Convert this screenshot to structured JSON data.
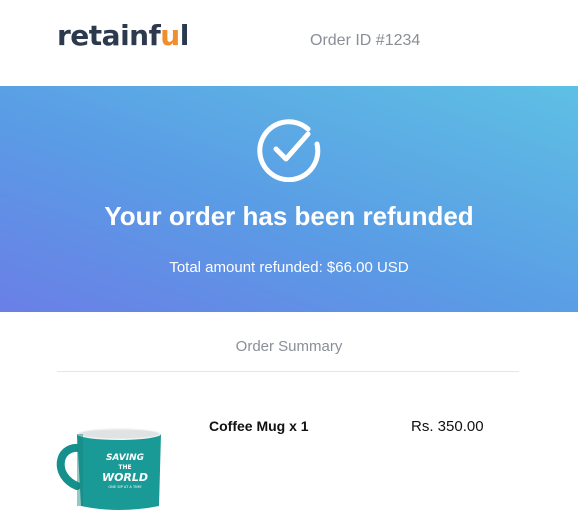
{
  "header": {
    "logo_main": "retainf",
    "logo_accent": "u",
    "logo_end": "l",
    "order_id": "Order ID #1234"
  },
  "hero": {
    "title": "Your order has been refunded",
    "subtitle": "Total amount refunded: $66.00 USD",
    "icon": "check-circle-icon"
  },
  "summary": {
    "title": "Order Summary",
    "items": [
      {
        "name": "Coffee Mug x 1",
        "price": "Rs. 350.00",
        "image_text": [
          "SAVING",
          "THE",
          "WORLD",
          "ONE SIP AT A TIME"
        ]
      }
    ]
  },
  "colors": {
    "brand_dark": "#2d3a4e",
    "brand_accent": "#f08d2c",
    "hero_gradient_start": "#6a7fe6",
    "hero_gradient_end": "#5ec0e4",
    "mug_color": "#1a9a96"
  }
}
